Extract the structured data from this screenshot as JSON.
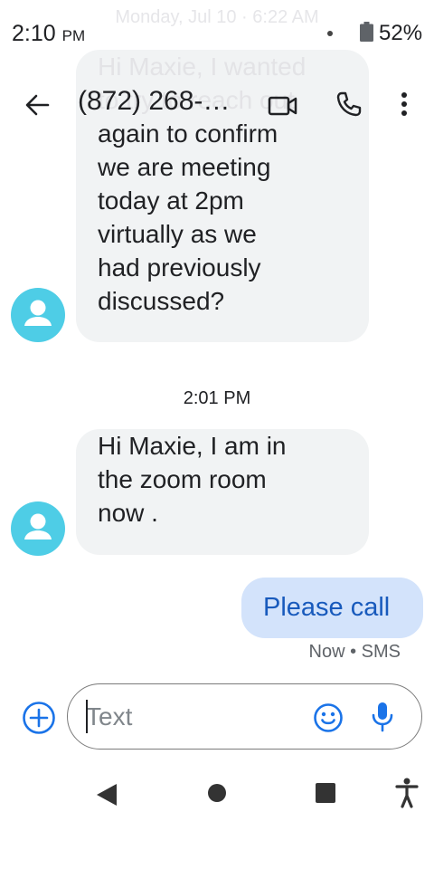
{
  "status_bar": {
    "time": "2:10",
    "time_suffix": "PM",
    "battery_percent": "52%"
  },
  "app_bar": {
    "title": "(872) 268-…",
    "icons": [
      "back-arrow-icon",
      "video-call-icon",
      "phone-call-icon",
      "more-vert-icon"
    ]
  },
  "conversation": {
    "scrolled_date_header": "Monday, Jul 10 · 6:22 AM",
    "messages": [
      {
        "direction": "incoming",
        "faded_lines": [
          "Hi Maxie, I wanted",
          "to try to reach out"
        ],
        "lines": [
          "again to confirm",
          "we are meeting",
          "today at 2pm",
          "virtually as we",
          "had previously",
          "discussed?"
        ]
      },
      {
        "direction": "incoming",
        "time_divider": "2:01 PM",
        "lines": [
          "Hi Maxie, I am in",
          "the zoom room",
          "now ."
        ]
      },
      {
        "direction": "outgoing",
        "text": "Please call",
        "status": "Now • SMS"
      }
    ]
  },
  "compose": {
    "placeholder": "Text",
    "value": "",
    "icons": [
      "add-circle-icon",
      "emoji-icon",
      "mic-icon"
    ]
  },
  "navigation": {
    "icons": [
      "nav-back-icon",
      "nav-home-icon",
      "nav-recents-icon",
      "accessibility-icon"
    ]
  },
  "colors": {
    "accent": "#1a73e8",
    "outgoing_bubble": "#d3e3fb",
    "outgoing_text": "#185abc",
    "incoming_bubble": "#f1f3f4",
    "avatar": "#4ecde6"
  }
}
